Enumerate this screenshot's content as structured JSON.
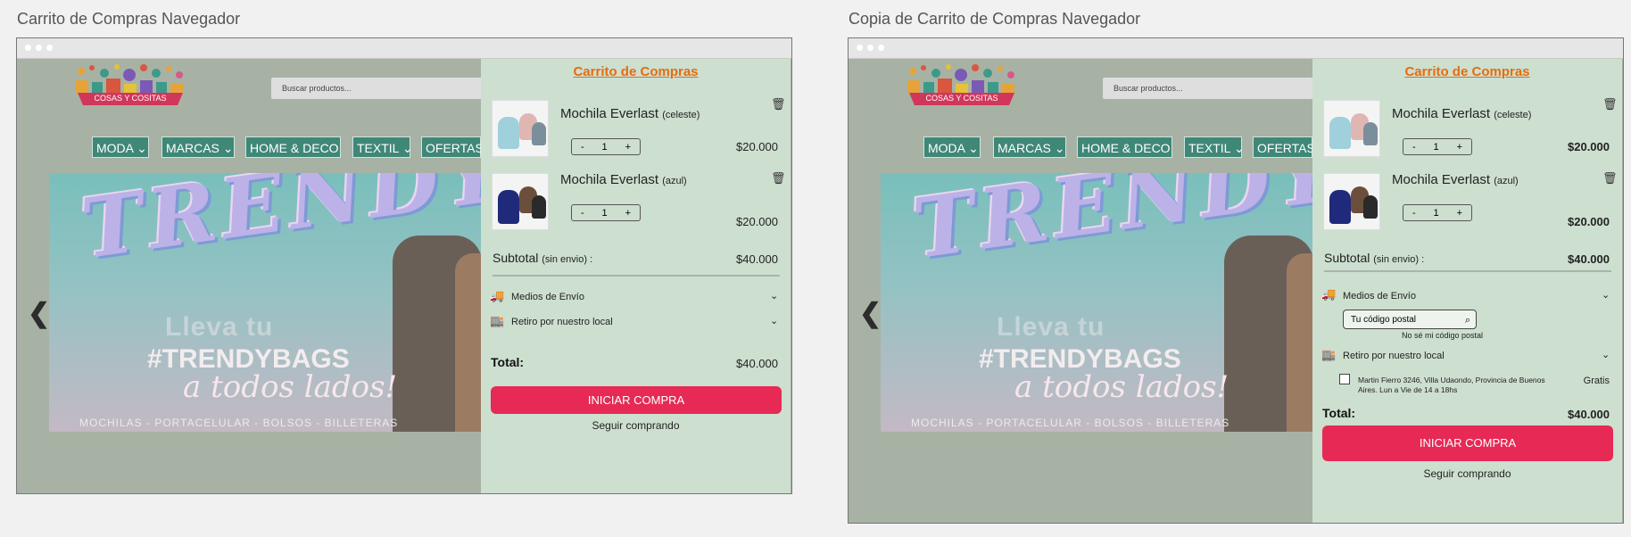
{
  "frames": [
    {
      "title": "Carrito de Compras Navegador",
      "search_placeholder": "Buscar productos...",
      "logo_text": "COSAS Y COSITAS",
      "nav": [
        "MODA",
        "MARCAS",
        "HOME & DECO",
        "TEXTIL",
        "OFERTAS"
      ],
      "banner": {
        "headline": "TRENDY",
        "line1": "Lleva tu",
        "line2": "#TRENDYBAGS",
        "line3": "a todos lados!",
        "categories": "MOCHILAS - PORTACELULAR - BOLSOS - BILLETERAS"
      },
      "cart": {
        "title": "Carrito de Compras",
        "items": [
          {
            "name": "Mochila Everlast",
            "variant": "(celeste)",
            "qty": "1",
            "price": "$20.000",
            "minus": "-",
            "plus": "+"
          },
          {
            "name": "Mochila Everlast",
            "variant": "(azul)",
            "qty": "1",
            "price": "$20.000",
            "minus": "-",
            "plus": "+"
          }
        ],
        "subtotal_label": "Subtotal",
        "subtotal_note": "(sin envio) :",
        "subtotal_value": "$40.000",
        "shipping_label": "Medios de Envío",
        "pickup_label": "Retiro por nuestro local",
        "total_label": "Total:",
        "total_value": "$40.000",
        "cta": "INICIAR COMPRA",
        "continue": "Seguir comprando"
      }
    },
    {
      "title": "Copia de Carrito de Compras Navegador",
      "search_placeholder": "Buscar productos...",
      "logo_text": "COSAS Y COSITAS",
      "nav": [
        "MODA",
        "MARCAS",
        "HOME & DECO",
        "TEXTIL",
        "OFERTAS"
      ],
      "banner": {
        "headline": "TRENDY",
        "line1": "Lleva tu",
        "line2": "#TRENDYBAGS",
        "line3": "a todos lados!",
        "categories": "MOCHILAS - PORTACELULAR - BOLSOS - BILLETERAS"
      },
      "cart": {
        "title": "Carrito de Compras",
        "items": [
          {
            "name": "Mochila Everlast",
            "variant": "(celeste)",
            "qty": "1",
            "price": "$20.000",
            "minus": "-",
            "plus": "+"
          },
          {
            "name": "Mochila Everlast",
            "variant": "(azul)",
            "qty": "1",
            "price": "$20.000",
            "minus": "-",
            "plus": "+"
          }
        ],
        "subtotal_label": "Subtotal",
        "subtotal_note": "(sin envio) :",
        "subtotal_value": "$40.000",
        "shipping_label": "Medios de Envío",
        "postal_placeholder": "Tu código postal",
        "postal_help": "No sé mi código postal",
        "pickup_label": "Retiro por nuestro local",
        "pickup_address": "Martin Fierro 3246, Villa Udaondo, Provincia de Buenos Aires. Lun a Vie de 14 a 18hs",
        "pickup_price": "Gratis",
        "total_label": "Total:",
        "total_value": "$40.000",
        "cta": "INICIAR COMPRA",
        "continue": "Seguir comprando"
      }
    }
  ],
  "colors": {
    "cart_bg": "#cddfcf",
    "store_bg": "#a7b2a4",
    "accent_orange": "#e46d10",
    "cta": "#e62a55",
    "nav": "#3f8777"
  },
  "icons": [
    "trash-icon",
    "truck-icon",
    "store-icon",
    "chevron-down-icon",
    "chevron-left-icon",
    "search-icon"
  ]
}
